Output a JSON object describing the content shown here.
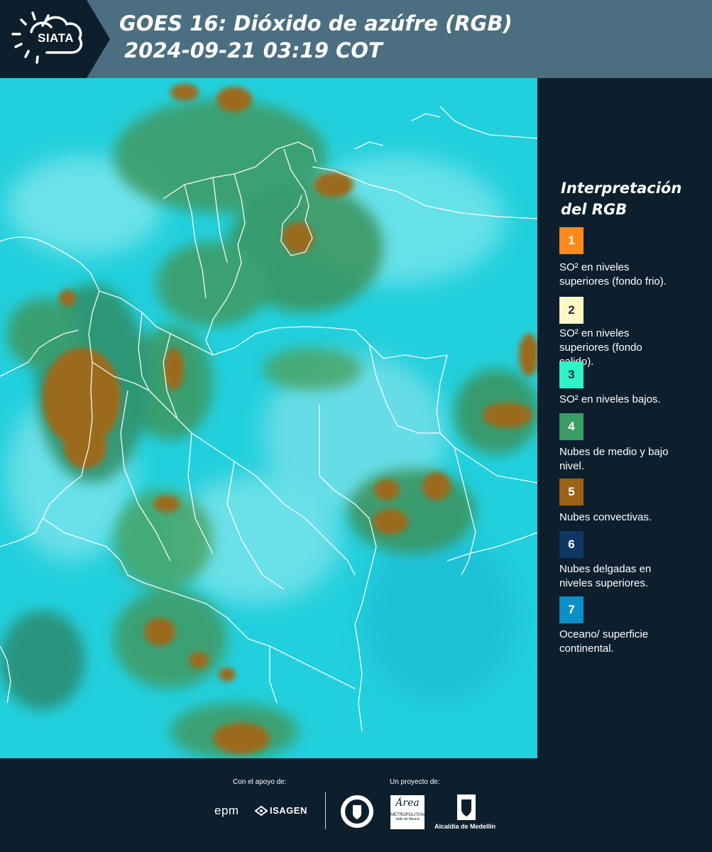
{
  "header": {
    "logo_text": "SIATA",
    "title_line1": "GOES 16: Dióxido de azúfre (RGB)",
    "title_line2": "2024-09-21 03:19 COT",
    "background": "#4b6f80"
  },
  "legend": {
    "title_line1": "Interpretación",
    "title_line2": "del RGB",
    "items": [
      {
        "number": "1",
        "color": "#ff8a1c",
        "text_line1": "SO² en niveles",
        "text_line2": "superiores (fondo frio)."
      },
      {
        "number": "2",
        "color": "#fff7c6",
        "text_line1": "SO² en niveles",
        "text_line2": "superiores (fondo",
        "text_line3": "calido)."
      },
      {
        "number": "3",
        "color": "#2ff1c8",
        "text_line1": "SO² en niveles bajos."
      },
      {
        "number": "4",
        "color": "#3a9b63",
        "text_line1": "Nubes de medio y bajo",
        "text_line2": "nivel."
      },
      {
        "number": "5",
        "color": "#9b6216",
        "text_line1": "Nubes convectivas."
      },
      {
        "number": "6",
        "color": "#0e3764",
        "text_line1": "Nubes delgadas en",
        "text_line2": "niveles superiores."
      },
      {
        "number": "7",
        "color": "#0c8fc8",
        "text_line1": "Oceano/ superficie",
        "text_line2": "continental."
      }
    ]
  },
  "footer": {
    "support_label": "Con el apoyo de:",
    "project_label": "Un proyecto de:",
    "sponsor1": "epm",
    "sponsor2": "ISAGEN",
    "sponsor3_line1": "Área",
    "sponsor3_line2": "METROPOLITANA",
    "sponsor3_line3": "Valle de Aburrá",
    "sponsor4": "Alcaldía de Medellín"
  }
}
